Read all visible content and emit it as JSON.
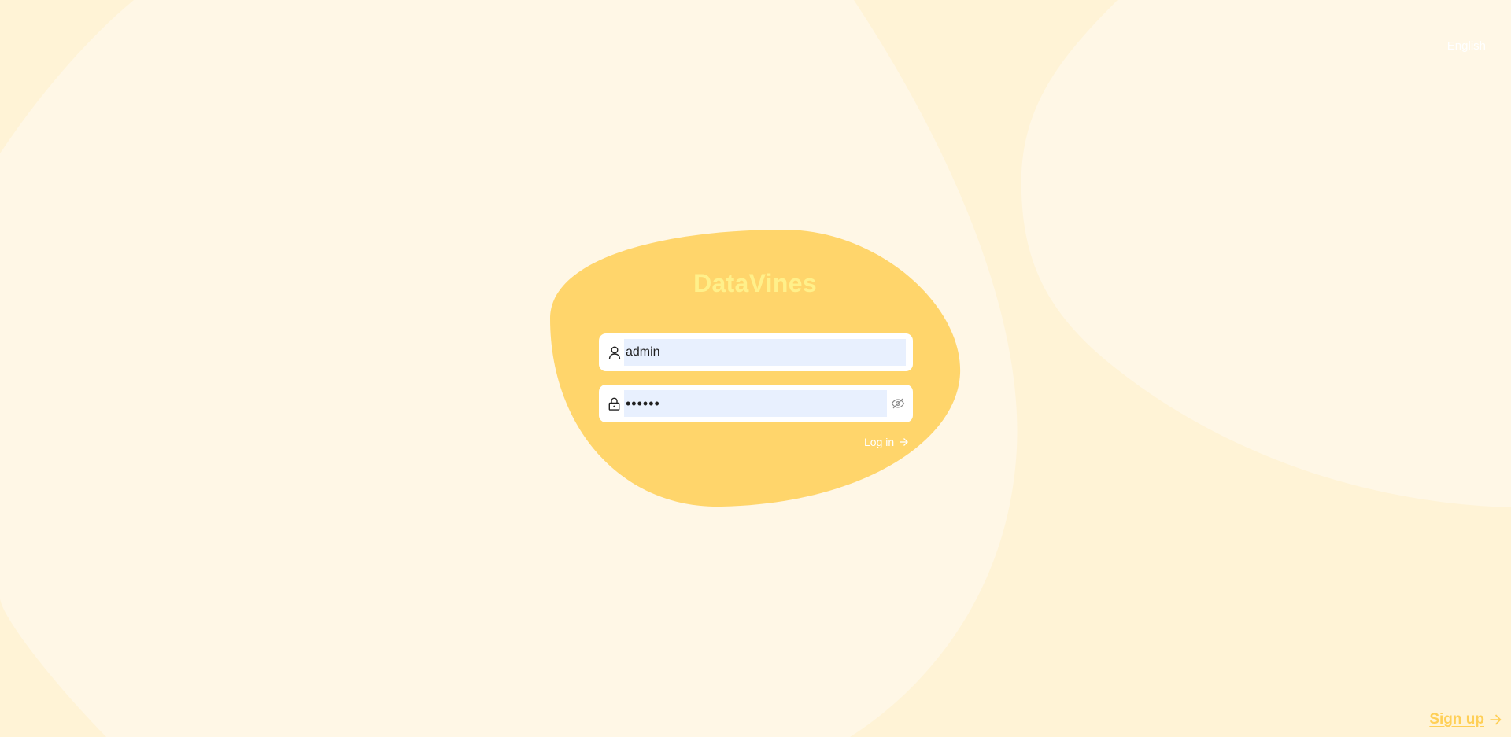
{
  "app": {
    "brand": "DataVines"
  },
  "header": {
    "language_label": "English"
  },
  "login_form": {
    "username": {
      "icon": "user-icon",
      "value": "admin"
    },
    "password": {
      "icon": "lock-icon",
      "value": "••••••",
      "toggle_icon": "eye-off-icon"
    },
    "submit_label": "Log in",
    "submit_icon": "arrow-right-icon"
  },
  "footer": {
    "signup_label": "Sign up",
    "signup_icon": "arrow-right-icon"
  },
  "colors": {
    "page_background": "#fff3d6",
    "light_blob": "#fff7e6",
    "card_blob": "#ffd56b",
    "brand_text": "#fff08a",
    "signup_text": "#ffcf56",
    "input_fill": "#e8f0fe"
  }
}
